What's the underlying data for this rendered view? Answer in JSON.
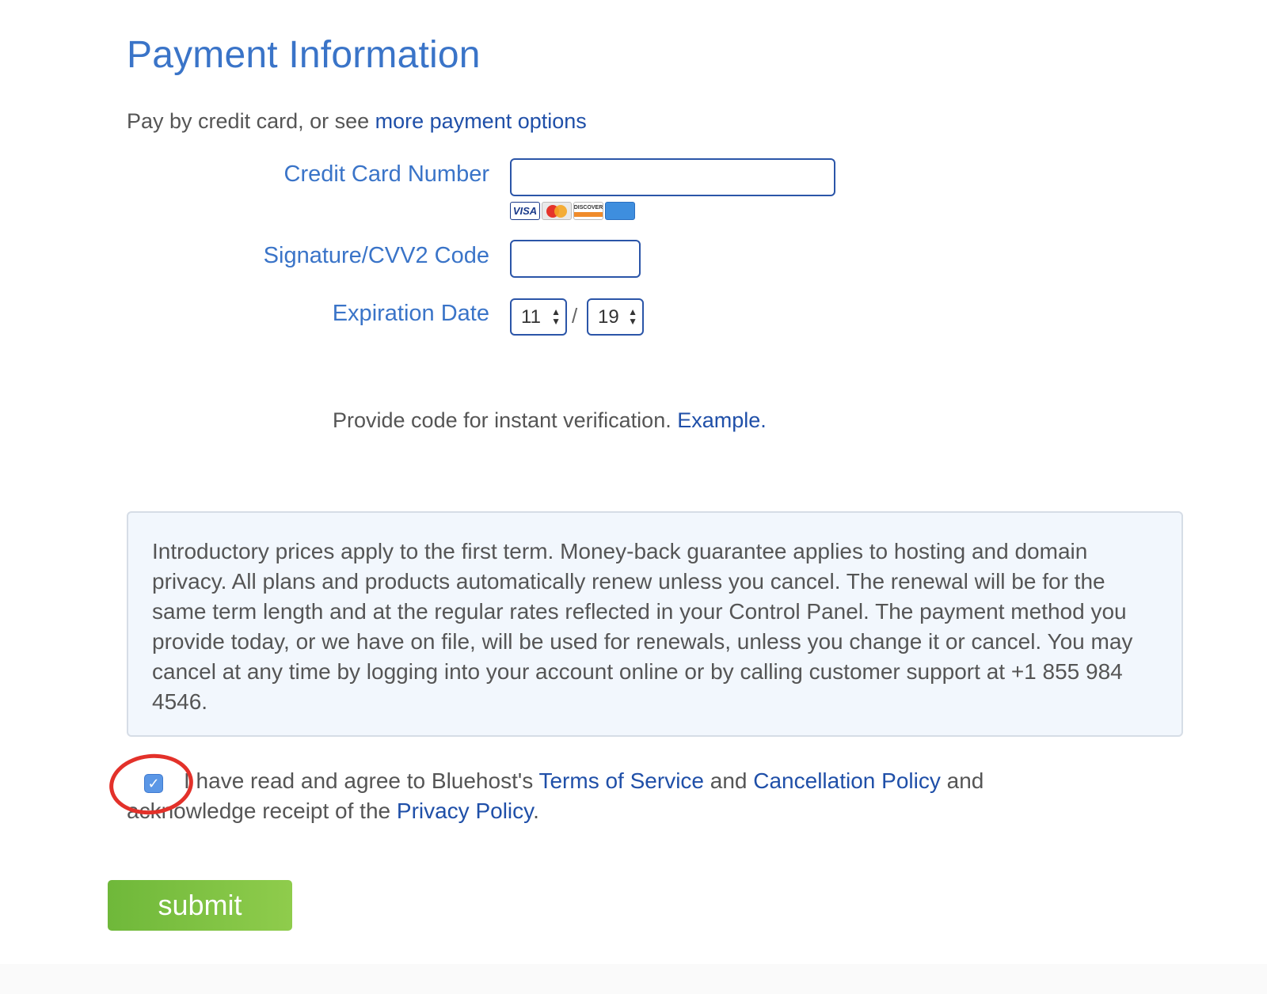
{
  "header": {
    "title": "Payment Information"
  },
  "intro": {
    "text": "Pay by credit card, or see ",
    "link": "more payment options"
  },
  "form": {
    "card_number_label": "Credit Card Number",
    "card_number_value": "",
    "cvv_label": "Signature/CVV2 Code",
    "cvv_value": "",
    "expiration_label": "Expiration Date",
    "exp_month": "11",
    "exp_year": "19",
    "separator": "/"
  },
  "card_logos": {
    "visa": "VISA",
    "discover": "DISCOVER"
  },
  "verification": {
    "text": "Provide code for instant verification. ",
    "link": "Example."
  },
  "notice": {
    "text": "Introductory prices apply to the first term. Money-back guarantee applies to hosting and domain privacy. All plans and products automatically renew unless you cancel. The renewal will be for the same term length and at the regular rates reflected in your Control Panel. The payment method you provide today, or we have on file, will be used for renewals, unless you change it or cancel. You may cancel at any time by logging into your account online or by calling customer support at +1 855 984 4546."
  },
  "agreement": {
    "checked": true,
    "checkmark": "✓",
    "text_1": "I have read and agree to Bluehost's ",
    "tos_link": "Terms of Service",
    "text_2": " and ",
    "cancel_link": "Cancellation Policy",
    "text_3": " and acknowledge receipt of the ",
    "privacy_link": "Privacy Policy",
    "text_4": "."
  },
  "submit": {
    "label": "submit"
  },
  "colors": {
    "title": "#3a74c8",
    "link": "#1f4fa8",
    "submit": "#7dc142",
    "highlight_circle": "#e3312a"
  }
}
